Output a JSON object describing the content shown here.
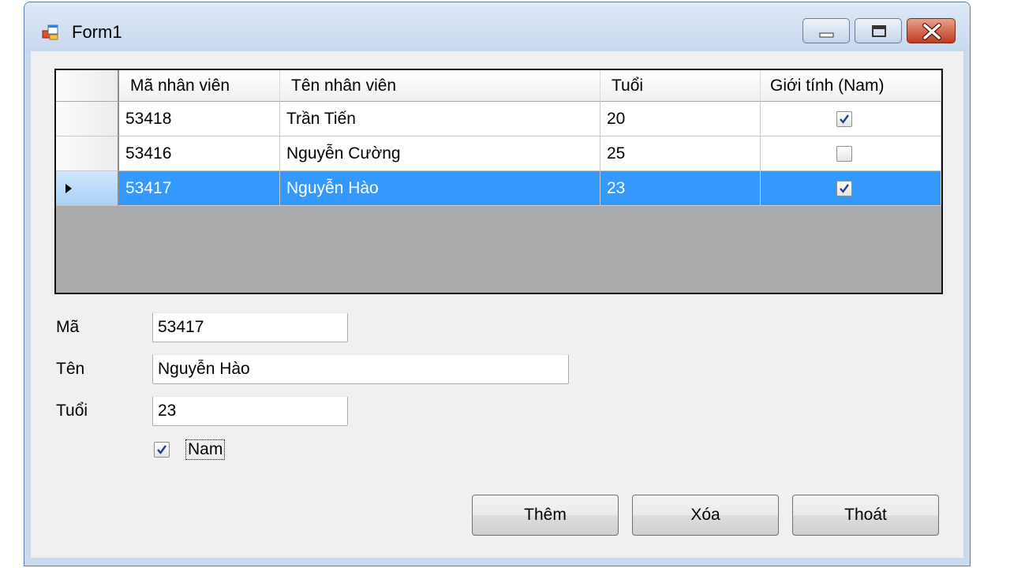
{
  "window": {
    "title": "Form1"
  },
  "grid": {
    "columns": [
      "Mã nhân viên",
      "Tên nhân viên",
      "Tuổi",
      "Giới tính (Nam)"
    ],
    "rows": [
      {
        "ma": "53418",
        "ten": "Trần Tiến",
        "tuoi": "20",
        "nam": true
      },
      {
        "ma": "53416",
        "ten": "Nguyễn Cường",
        "tuoi": "25",
        "nam": false
      },
      {
        "ma": "53417",
        "ten": "Nguyễn Hào",
        "tuoi": "23",
        "nam": true,
        "selected": true
      }
    ]
  },
  "form": {
    "ma_label": "Mã",
    "ma_value": "53417",
    "ten_label": "Tên",
    "ten_value": "Nguyễn Hào",
    "tuoi_label": "Tuổi",
    "tuoi_value": "23",
    "nam_label": "Nam",
    "nam_checked": true
  },
  "buttons": {
    "them": "Thêm",
    "xoa": "Xóa",
    "thoat": "Thoát"
  },
  "colors": {
    "selection": "#3399ff",
    "grid_background": "#ababab",
    "form_background": "#f0f0f0"
  }
}
